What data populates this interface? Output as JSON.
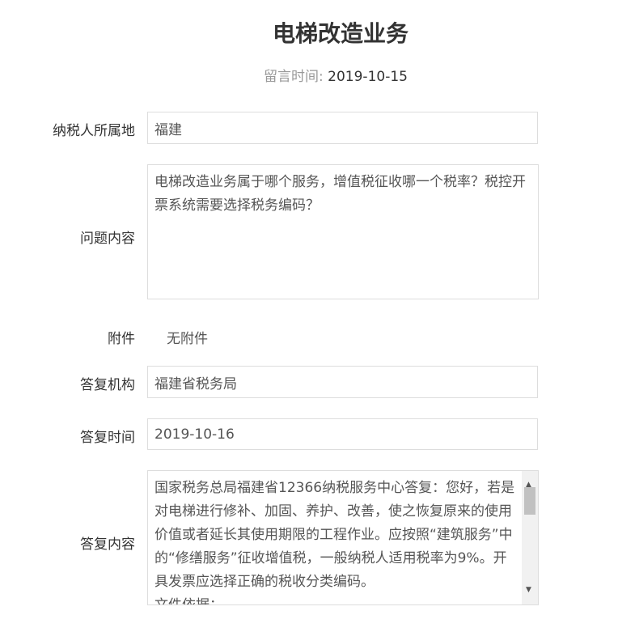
{
  "title": "电梯改造业务",
  "message_time": {
    "label": "留言时间:",
    "value": "2019-10-15"
  },
  "fields": {
    "region": {
      "label": "纳税人所属地",
      "value": "福建"
    },
    "question": {
      "label": "问题内容",
      "value": "电梯改造业务属于哪个服务，增值税征收哪一个税率？税控开票系统需要选择税务编码？"
    },
    "attachment": {
      "label": "附件",
      "value": "无附件"
    },
    "org": {
      "label": "答复机构",
      "value": "福建省税务局"
    },
    "answer_time": {
      "label": "答复时间",
      "value": "2019-10-16"
    },
    "answer": {
      "label": "答复内容",
      "value": "国家税务总局福建省12366纳税服务中心答复：您好，若是对电梯进行修补、加固、养护、改善，使之恢复原来的使用价值或者延长其使用期限的工程作业。应按照“建筑服务”中的“修缮服务”征收增值税，一般纳税人适用税率为9%。开具发票应选择正确的税收分类编码。",
      "value2": "文件依据："
    }
  }
}
